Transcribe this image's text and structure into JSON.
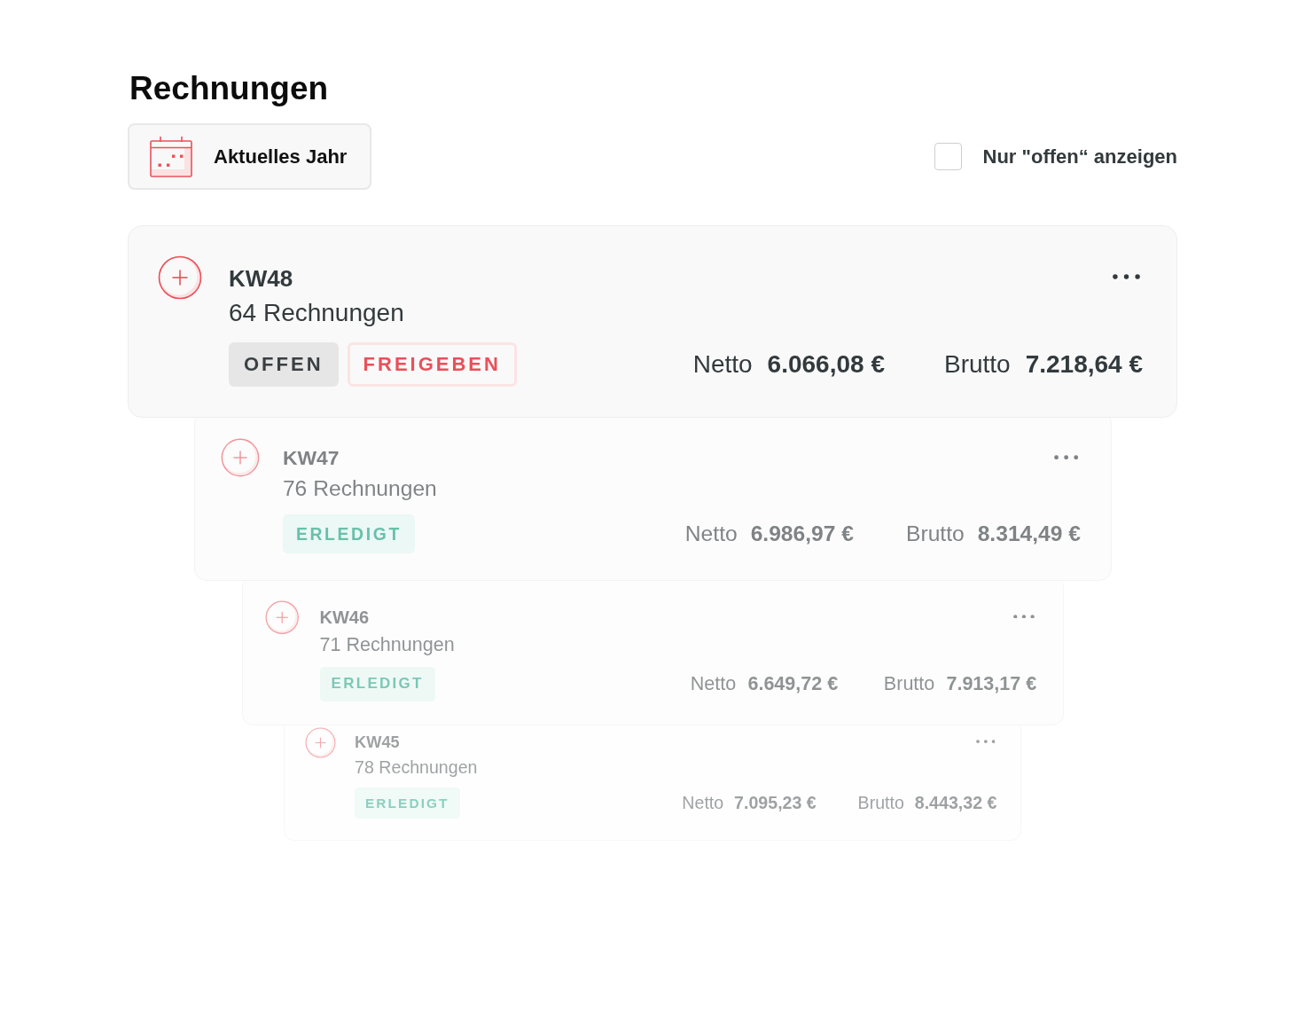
{
  "page": {
    "title": "Rechnungen"
  },
  "toolbar": {
    "date_filter": {
      "label": "Aktuelles Jahr"
    },
    "open_only_filter": {
      "label": "Nur \"offen“ anzeigen",
      "checked": false
    }
  },
  "weeks": [
    {
      "title": "KW48",
      "count": "64 Rechnungen",
      "expanded": false,
      "status": {
        "label": "OFFEN",
        "kind": "open"
      },
      "action": {
        "label": "FREIGEBEN"
      },
      "netto_label": "Netto",
      "netto": "6.066,08 €",
      "brutto_label": "Brutto",
      "brutto": "7.218,64 €"
    },
    {
      "title": "KW47",
      "count": "76 Rechnungen",
      "expanded": false,
      "status": {
        "label": "ERLEDIGT",
        "kind": "done"
      },
      "netto_label": "Netto",
      "netto": "6.986,97 €",
      "brutto_label": "Brutto",
      "brutto": "8.314,49 €"
    },
    {
      "title": "KW46",
      "count": "71 Rechnungen",
      "expanded": false,
      "status": {
        "label": "ERLEDIGT",
        "kind": "done"
      },
      "netto_label": "Netto",
      "netto": "6.649,72 €",
      "brutto_label": "Brutto",
      "brutto": "7.913,17 €"
    },
    {
      "title": "KW45",
      "count": "78 Rechnungen",
      "expanded": false,
      "status": {
        "label": "ERLEDIGT",
        "kind": "done"
      },
      "netto_label": "Netto",
      "netto": "7.095,23 €",
      "brutto_label": "Brutto",
      "brutto": "8.443,32 €"
    }
  ]
}
